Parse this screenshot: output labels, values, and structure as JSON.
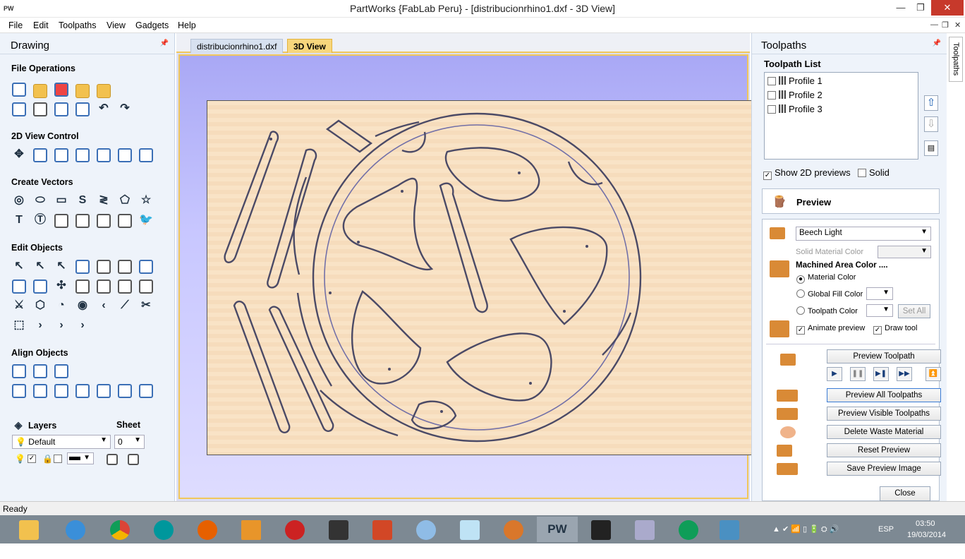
{
  "window": {
    "title": "PartWorks {FabLab Peru} - [distribucionrhino1.dxf - 3D View]",
    "app_icon": "PW"
  },
  "menu": [
    "File",
    "Edit",
    "Toolpaths",
    "View",
    "Gadgets",
    "Help"
  ],
  "left": {
    "title": "Drawing",
    "sections": [
      "File Operations",
      "2D View Control",
      "Create Vectors",
      "Edit Objects",
      "Align Objects"
    ],
    "layers_label": "Layers",
    "sheet_label": "Sheet",
    "layer_value": "Default",
    "sheet_value": "0"
  },
  "tabs": [
    "distribucionrhino1.dxf",
    "3D View"
  ],
  "right": {
    "title": "Toolpaths",
    "list_title": "Toolpath List",
    "items": [
      "Profile 1",
      "Profile 2",
      "Profile 3"
    ],
    "show2d": "Show 2D previews",
    "solid": "Solid",
    "preview": "Preview",
    "material": "Beech Light",
    "solid_material_color": "Solid Material Color",
    "machined_area_color": "Machined Area Color ....",
    "material_color": "Material Color",
    "global_fill": "Global Fill Color",
    "toolpath_color": "Toolpath Color",
    "set_all": "Set All",
    "animate": "Animate preview",
    "draw_tool": "Draw tool",
    "buttons": [
      "Preview Toolpath",
      "Preview All Toolpaths",
      "Preview Visible Toolpaths",
      "Delete Waste Material",
      "Reset Preview",
      "Save Preview Image"
    ],
    "close": "Close",
    "side_tab": "Toolpaths"
  },
  "status": "Ready",
  "tray": {
    "lang": "ESP",
    "time": "03:50",
    "date": "19/03/2014"
  },
  "taskbar_apps": [
    "PW"
  ],
  "colors": {
    "accent": "#f1c75b",
    "panel": "#eef3fa",
    "board": "#f9e3c6"
  }
}
